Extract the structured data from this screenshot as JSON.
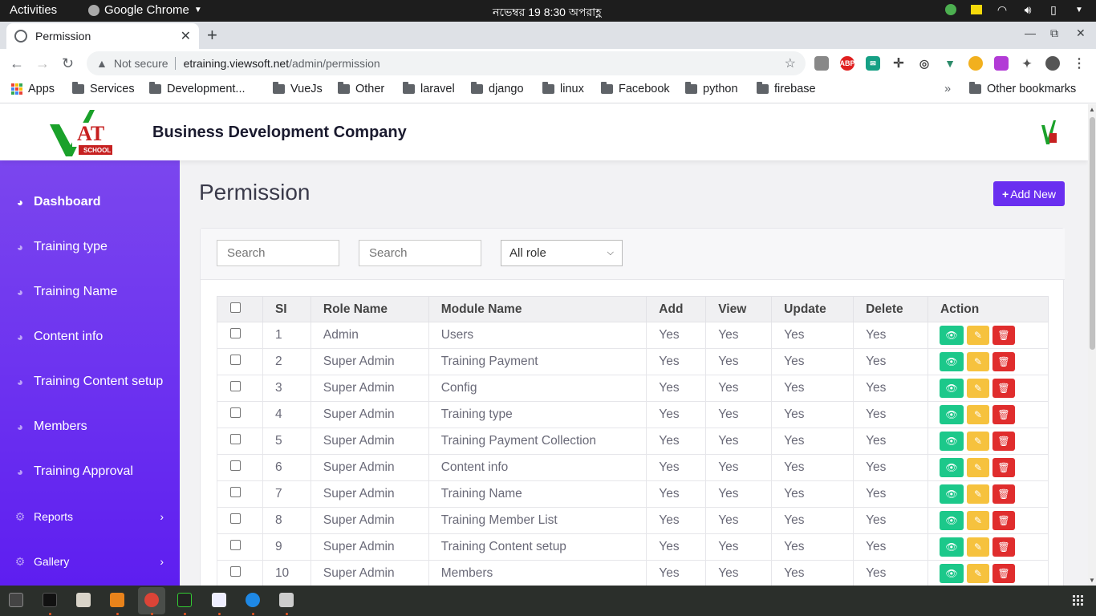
{
  "system": {
    "activities": "Activities",
    "app_name": "Google Chrome",
    "clock": "নভেম্বর 19  8:30 অপরাহ্ণ"
  },
  "browser": {
    "tab_title": "Permission",
    "not_secure": "Not secure",
    "url_host": "etraining.viewsoft.net",
    "url_path": "/admin/permission",
    "bookmarks": [
      "Apps",
      "Services",
      "Development...",
      "VueJs",
      "Other",
      "laravel",
      "django",
      "linux",
      "Facebook",
      "python",
      "firebase"
    ],
    "other_bookmarks": "Other bookmarks",
    "overflow": "»"
  },
  "header": {
    "company": "Business Development Company",
    "logo_text": "AT",
    "logo_sub": "SCHOOL"
  },
  "sidebar": {
    "items": [
      {
        "label": "Dashboard",
        "icon": "dashboard-icon"
      },
      {
        "label": "Training type",
        "icon": "dashboard-icon"
      },
      {
        "label": "Training Name",
        "icon": "dashboard-icon"
      },
      {
        "label": "Content info",
        "icon": "dashboard-icon"
      },
      {
        "label": "Training Content setup",
        "icon": "dashboard-icon"
      },
      {
        "label": "Members",
        "icon": "dashboard-icon"
      },
      {
        "label": "Training Approval",
        "icon": "dashboard-icon"
      },
      {
        "label": "Reports",
        "icon": "gear-icon"
      },
      {
        "label": "Gallery",
        "icon": "gear-icon"
      }
    ]
  },
  "main": {
    "title": "Permission",
    "add_new": "Add New",
    "search1_placeholder": "Search",
    "search2_placeholder": "Search",
    "role_select": "All role"
  },
  "table": {
    "headers": [
      "SI",
      "Role Name",
      "Module Name",
      "Add",
      "View",
      "Update",
      "Delete",
      "Action"
    ],
    "rows": [
      [
        "1",
        "Admin",
        "Users",
        "Yes",
        "Yes",
        "Yes",
        "Yes"
      ],
      [
        "2",
        "Super Admin",
        "Training Payment",
        "Yes",
        "Yes",
        "Yes",
        "Yes"
      ],
      [
        "3",
        "Super Admin",
        "Config",
        "Yes",
        "Yes",
        "Yes",
        "Yes"
      ],
      [
        "4",
        "Super Admin",
        "Training type",
        "Yes",
        "Yes",
        "Yes",
        "Yes"
      ],
      [
        "5",
        "Super Admin",
        "Training Payment Collection",
        "Yes",
        "Yes",
        "Yes",
        "Yes"
      ],
      [
        "6",
        "Super Admin",
        "Content info",
        "Yes",
        "Yes",
        "Yes",
        "Yes"
      ],
      [
        "7",
        "Super Admin",
        "Training Name",
        "Yes",
        "Yes",
        "Yes",
        "Yes"
      ],
      [
        "8",
        "Super Admin",
        "Training Member List",
        "Yes",
        "Yes",
        "Yes",
        "Yes"
      ],
      [
        "9",
        "Super Admin",
        "Training Content setup",
        "Yes",
        "Yes",
        "Yes",
        "Yes"
      ],
      [
        "10",
        "Super Admin",
        "Members",
        "Yes",
        "Yes",
        "Yes",
        "Yes"
      ]
    ]
  },
  "colors": {
    "sidebar": "#6a2ff0",
    "view_btn": "#1cc88a",
    "edit_btn": "#f6c23e",
    "delete_btn": "#e02d2d"
  }
}
